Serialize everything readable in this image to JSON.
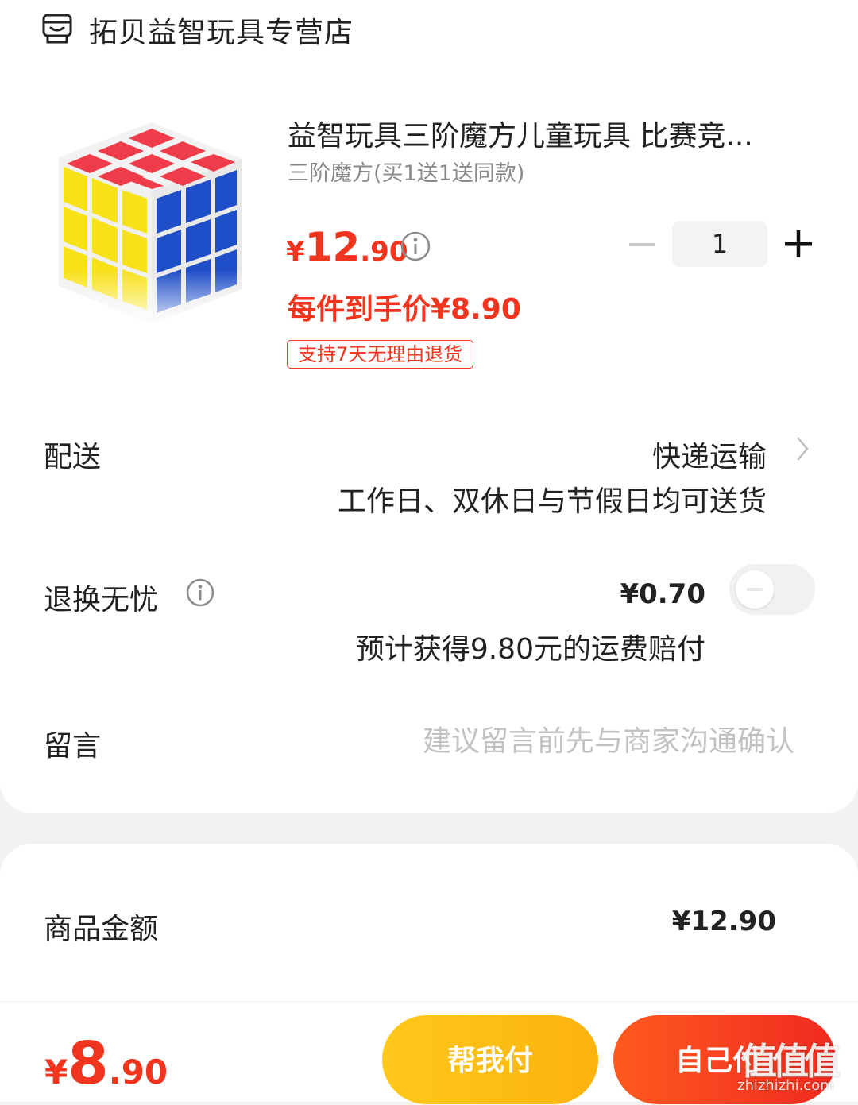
{
  "store": {
    "name": "拓贝益智玩具专营店",
    "icon": "store-icon"
  },
  "product": {
    "title": "益智玩具三阶魔方儿童玩具 比赛竞...",
    "sku": "三阶魔方(买1送1送同款)",
    "price_symbol": "¥",
    "price_int": "12",
    "price_dec": ".90",
    "final_price": "每件到手价¥8.90",
    "return_tag": "支持7天无理由退货",
    "quantity": "1",
    "image": "rubiks-cube-image"
  },
  "delivery": {
    "label": "配送",
    "method": "快递运输",
    "desc": "工作日、双休日与节假日均可送货"
  },
  "return_insurance": {
    "label": "退换无忧",
    "price": "¥0.70",
    "compensation": "预计获得9.80元的运费赔付",
    "enabled": false
  },
  "message": {
    "label": "留言",
    "placeholder": "建议留言前先与商家沟通确认",
    "value": ""
  },
  "summary": {
    "amount_label": "商品金额",
    "amount_value": "¥12.90"
  },
  "bottom": {
    "total_symbol": "¥",
    "total_int": "8",
    "total_dec": ".90",
    "help_pay": "帮我付",
    "self_pay": "自己付"
  },
  "watermark": {
    "logo": "值值值",
    "site": "zhizhizhi.com"
  },
  "colors": {
    "accent": "#f0341e",
    "help_button": "#fbb30d",
    "self_button": "#f02a20"
  }
}
